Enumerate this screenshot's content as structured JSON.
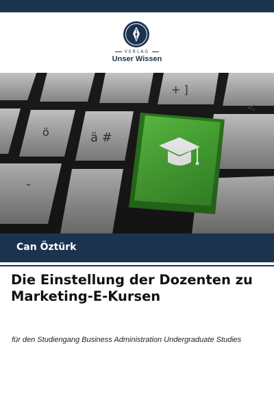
{
  "publisher": {
    "imprint_label": "VERLAG",
    "name": "Unser Wissen"
  },
  "author": {
    "name": "Can Öztürk"
  },
  "book": {
    "title": "Die Einstellung der Dozenten zu Marketing-E-Kursen",
    "subtitle": "für den Studiengang Business Administration Undergraduate Studies"
  },
  "cover_image": {
    "keys": [
      {
        "label": "+ ]"
      },
      {
        "label": "ö"
      },
      {
        "label": "ä #"
      },
      {
        "label": "-"
      },
      {
        "label": "<"
      }
    ],
    "highlight_icon": "graduation-cap-icon",
    "highlight_color": "#4caf37"
  },
  "colors": {
    "brand": "#1c3350",
    "accent": "#4caf37"
  }
}
